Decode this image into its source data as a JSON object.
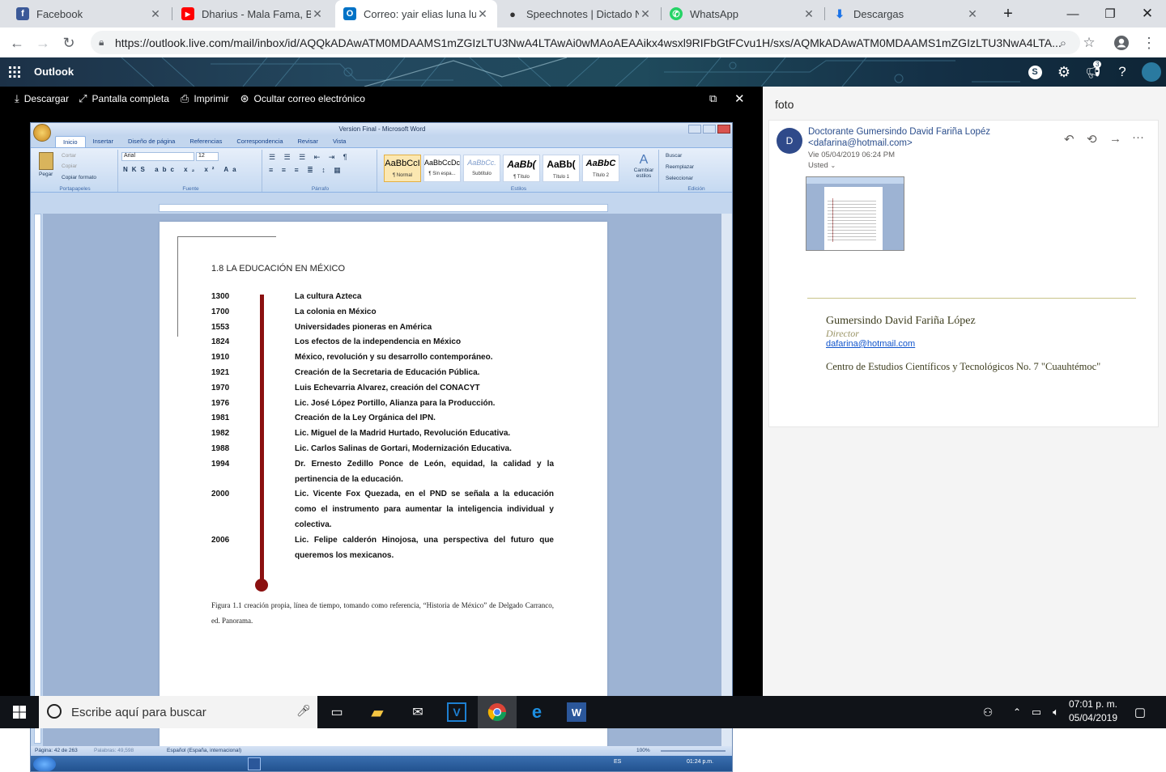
{
  "browser": {
    "tabs": [
      {
        "title": "Facebook",
        "icon": "facebook-icon",
        "color": "#3b5998",
        "glyph": "f"
      },
      {
        "title": "Dharius - Mala Fama, Buen",
        "icon": "youtube-icon",
        "color": "#ff0000",
        "glyph": "▶"
      },
      {
        "title": "Correo: yair elias luna luna",
        "icon": "outlook-icon",
        "color": "#0072c6",
        "glyph": "O"
      },
      {
        "title": "Speechnotes | Dictado No",
        "icon": "microphone-icon",
        "color": "#333333",
        "glyph": "🎤"
      },
      {
        "title": "WhatsApp",
        "icon": "whatsapp-icon",
        "color": "#25d366",
        "glyph": "✆"
      },
      {
        "title": "Descargas",
        "icon": "download-icon",
        "color": "#1a73e8",
        "glyph": "⬇"
      }
    ],
    "url": "https://outlook.live.com/mail/inbox/id/AQQkADAwATM0MDAAMS1mZGIzLTU3NwA4LTAwAi0wMAoAEAAikx4wsxl9RIFbGtFCvu1H/sxs/AQMkADAwATM0MDAAMS1mZGIzLTU3NwA4LTA..."
  },
  "outlook": {
    "app_name": "Outlook",
    "notification_count": "3"
  },
  "viewer": {
    "download": "Descargar",
    "fullscreen": "Pantalla completa",
    "print": "Imprimir",
    "hide_mail": "Ocultar correo electrónico"
  },
  "word": {
    "title": "Version Final - Microsoft Word",
    "tabs": [
      "Inicio",
      "Insertar",
      "Diseño de página",
      "Referencias",
      "Correspondencia",
      "Revisar",
      "Vista"
    ],
    "clipboard": {
      "paste": "Pegar",
      "cut": "Cortar",
      "copy": "Copiar",
      "format": "Copiar formato",
      "label": "Portapapeles"
    },
    "font": {
      "name": "Arial",
      "size": "12",
      "label": "Fuente"
    },
    "paragraph_label": "Párrafo",
    "styles": [
      {
        "preview": "AaBbCcI",
        "name": "¶ Normal"
      },
      {
        "preview": "AaBbCcDc",
        "name": "¶ Sin espa..."
      },
      {
        "preview": "AaBbCc.",
        "name": "Subtítulo"
      },
      {
        "preview": "AaBb(",
        "name": "¶ Título"
      },
      {
        "preview": "AaBb(",
        "name": "Título 1"
      },
      {
        "preview": "AaBbC",
        "name": "Título 2"
      }
    ],
    "change_styles": "Cambiar estilos",
    "styles_label": "Estilos",
    "edit": {
      "find": "Buscar",
      "replace": "Reemplazar",
      "select": "Seleccionar",
      "label": "Edición"
    },
    "doc": {
      "heading": "1.8 LA EDUCACIÓN  EN MÉXICO",
      "timeline": [
        {
          "year": "1300",
          "event": "La cultura  Azteca"
        },
        {
          "year": "1700",
          "event": "La colonia en México"
        },
        {
          "year": "1553",
          "event": "Universidades pioneras en América"
        },
        {
          "year": "1824",
          "event": "Los efectos de la independencia en México"
        },
        {
          "year": "1910",
          "event": "México, revolución y su desarrollo contemporáneo."
        },
        {
          "year": "1921",
          "event": "Creación de la Secretaria de Educación Pública."
        },
        {
          "year": "1970",
          "event": "Luis Echevarria Alvarez, creación del CONACYT"
        },
        {
          "year": "1976",
          "event": "Lic. José López Portillo, Alianza para la Producción."
        },
        {
          "year": "1981",
          "event": "Creación de la Ley Orgánica del IPN."
        },
        {
          "year": "1982",
          "event": "Lic. Miguel de la Madrid Hurtado, Revolución Educativa."
        },
        {
          "year": "1988",
          "event": "Lic. Carlos Salinas de Gortari, Modernización Educativa."
        },
        {
          "year": "1994",
          "event": "Dr. Ernesto Zedillo Ponce de León, equidad, la calidad y la pertinencia de la educación."
        },
        {
          "year": "2000",
          "event": "Lic. Vicente Fox Quezada, en el PND se señala a la educación como el instrumento para aumentar la inteligencia individual y colectiva."
        },
        {
          "year": "2006",
          "event": "Lic. Felipe calderón Hinojosa, una perspectiva del futuro que queremos los mexicanos."
        }
      ],
      "caption": "Figura 1.1 creación propia, línea de tiempo, tomando como referencia, “Historia de México” de Delgado Carranco, ed. Panorama."
    },
    "status": {
      "page": "Página: 42 de 263",
      "words": "Palabras: 49,598",
      "lang": "Español (España, internacional)",
      "zoom": "100%"
    },
    "taskbar": {
      "lang": "ES",
      "time": "01:24 p.m."
    }
  },
  "mail": {
    "subject": "foto",
    "avatar_letter": "D",
    "sender_name": "Doctorante Gumersindo David Fariña Lopéz",
    "sender_email": "<dafarina@hotmail.com>",
    "date": "Vie 05/04/2019 06:24 PM",
    "to": "Usted",
    "signature": {
      "name": "Gumersindo David Fariña López",
      "role": "Director",
      "email": "dafarina@hotmail.com",
      "org": "Centro de Estudios Científicos y Tecnológicos No. 7 \"Cuauhtémoc\""
    }
  },
  "taskbar": {
    "search_placeholder": "Escribe aquí para buscar",
    "time": "07:01 p. m.",
    "date": "05/04/2019"
  }
}
